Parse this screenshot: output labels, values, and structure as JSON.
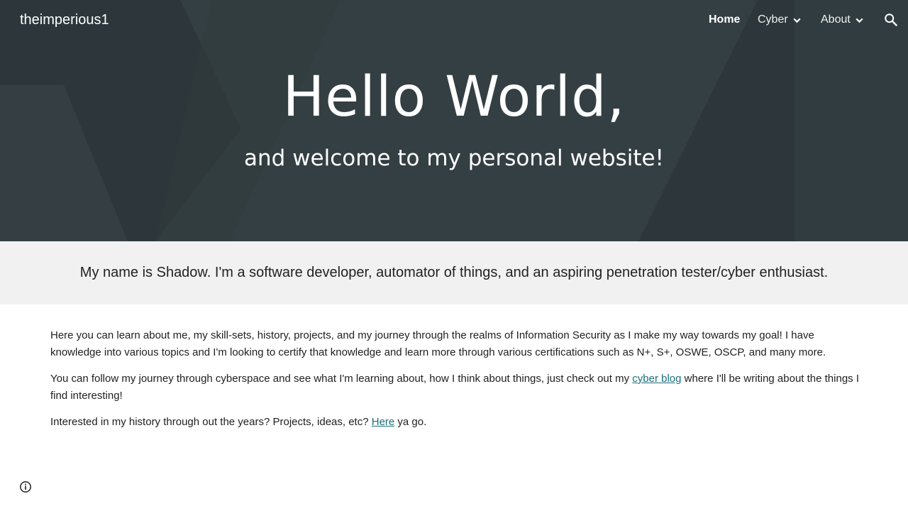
{
  "header": {
    "site_title": "theimperious1",
    "nav": {
      "home": "Home",
      "cyber": "Cyber",
      "about": "About"
    },
    "icons": {
      "search": "search-icon",
      "chevron": "chevron-down-icon"
    }
  },
  "hero": {
    "title": "Hello World,",
    "subtitle": "and welcome to my personal website!"
  },
  "band": {
    "text": "My name is Shadow. I'm a software developer, automator of things, and an aspiring penetration tester/cyber enthusiast."
  },
  "content": {
    "p1": "Here you can learn about me, my skill-sets, history, projects, and my journey through the realms of Information Security as I make my way towards my goal! I have knowledge into various topics and I'm looking to certify that knowledge and learn more through various certifications such as N+, S+, OSWE, OSCP, and many more.",
    "p2_before": "You can follow my journey through cyberspace and see what I'm learning about, how I think about things, just check out my ",
    "p2_link": "cyber blog",
    "p2_after": " where I'll be writing about the things I find interesting!",
    "p3_before": "Interested in my history through out the years? Projects, ideas, etc? ",
    "p3_link": "Here",
    "p3_after": " ya go."
  },
  "footer": {
    "info_icon": "info-icon"
  },
  "colors": {
    "hero_bg": "#3b474d",
    "band_bg": "#f1f1f1",
    "link": "#1a6e7a"
  }
}
